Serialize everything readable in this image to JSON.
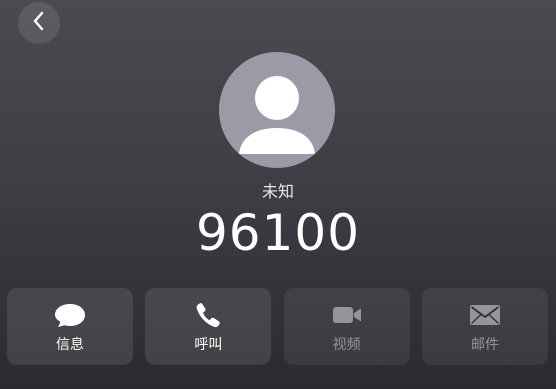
{
  "contact": {
    "name": "未知",
    "number": "96100"
  },
  "actions": [
    {
      "label": "信息",
      "icon": "message-icon",
      "enabled": true
    },
    {
      "label": "呼叫",
      "icon": "phone-icon",
      "enabled": true
    },
    {
      "label": "视频",
      "icon": "video-icon",
      "enabled": false
    },
    {
      "label": "邮件",
      "icon": "mail-icon",
      "enabled": false
    }
  ],
  "colors": {
    "background_top": "#4a4b51",
    "background_bottom": "#2a2b30",
    "avatar_bg": "#9a9ba6",
    "text": "#ffffff"
  }
}
